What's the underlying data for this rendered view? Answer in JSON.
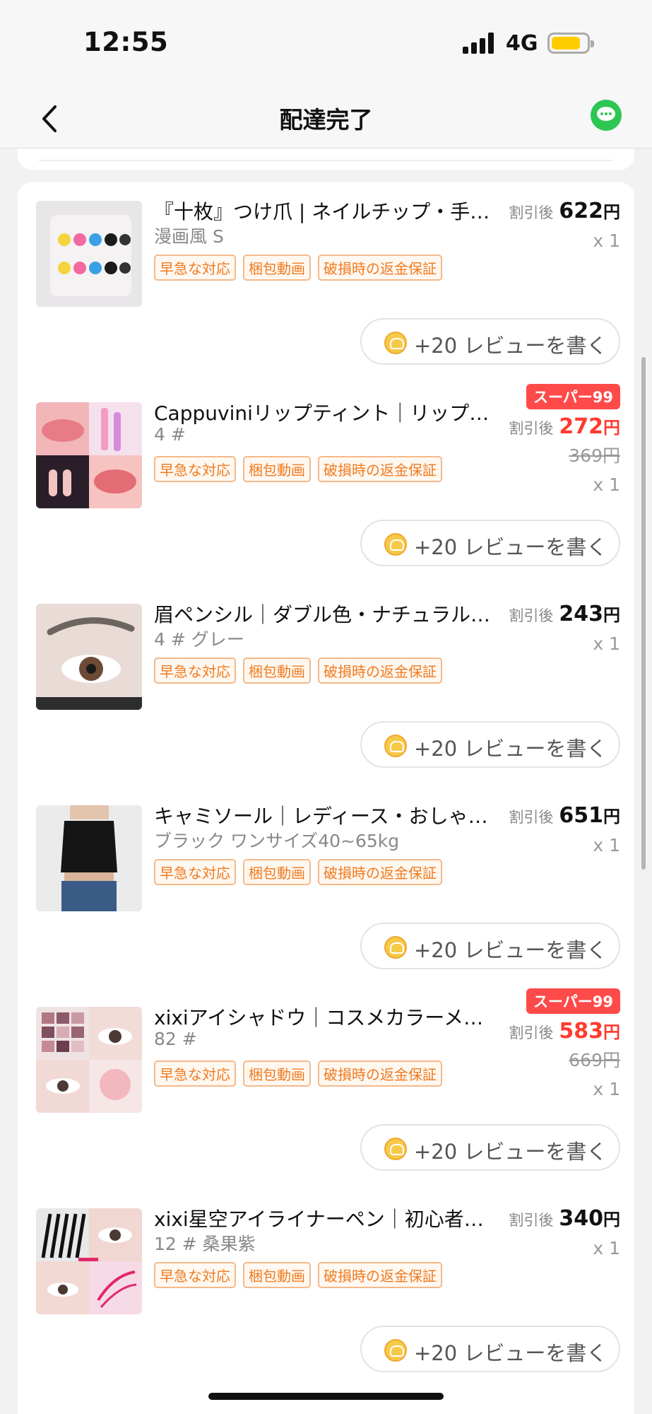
{
  "status": {
    "time": "12:55",
    "network": "4G"
  },
  "nav": {
    "title": "配達完了"
  },
  "items": [
    {
      "title": "『十枚』つけ爪 | ネイルチップ・手…",
      "variant": "漫画風 S",
      "tags": [
        "早急な対応",
        "梱包動画",
        "破損時の返金保証"
      ],
      "badge": "",
      "discount_label": "割引後",
      "price": "622",
      "currency": "円",
      "original_price": "",
      "qty": "x 1",
      "review": "+20 レビューを書く"
    },
    {
      "title": "Cappuviniリップティント｜リップ…",
      "variant": "4 #",
      "tags": [
        "早急な対応",
        "梱包動画",
        "破損時の返金保証"
      ],
      "badge": "スーパー99",
      "discount_label": "割引後",
      "price": "272",
      "currency": "円",
      "original_price": "369円",
      "qty": "x 1",
      "review": "+20 レビューを書く"
    },
    {
      "title": "眉ペンシル｜ダブル色・ナチュラル…",
      "variant": "4 # グレー",
      "tags": [
        "早急な対応",
        "梱包動画",
        "破損時の返金保証"
      ],
      "badge": "",
      "discount_label": "割引後",
      "price": "243",
      "currency": "円",
      "original_price": "",
      "qty": "x 1",
      "review": "+20 レビューを書く"
    },
    {
      "title": "キャミソール｜レディース・おしゃ…",
      "variant": "ブラック ワンサイズ40~65kg",
      "tags": [
        "早急な対応",
        "梱包動画",
        "破損時の返金保証"
      ],
      "badge": "",
      "discount_label": "割引後",
      "price": "651",
      "currency": "円",
      "original_price": "",
      "qty": "x 1",
      "review": "+20 レビューを書く"
    },
    {
      "title": "xixiアイシャドウ｜コスメカラーメ…",
      "variant": "82 #",
      "tags": [
        "早急な対応",
        "梱包動画",
        "破損時の返金保証"
      ],
      "badge": "スーパー99",
      "discount_label": "割引後",
      "price": "583",
      "currency": "円",
      "original_price": "669円",
      "qty": "x 1",
      "review": "+20 レビューを書く"
    },
    {
      "title": "xixi星空アイライナーペン｜初心者…",
      "variant": "12 # 桑果紫",
      "tags": [
        "早急な対応",
        "梱包動画",
        "破損時の返金保証"
      ],
      "badge": "",
      "discount_label": "割引後",
      "price": "340",
      "currency": "円",
      "original_price": "",
      "qty": "x 1",
      "review": "+20 レビューを書く"
    }
  ],
  "colors": {
    "accent_red": "#ff3b2f",
    "tag_orange": "#f07a1e",
    "chat_green": "#2dc653",
    "battery_yellow": "#ffcc00"
  },
  "icons": {
    "back": "chevron-left-icon",
    "chat": "chat-bubble-icon",
    "coin": "coin-icon"
  }
}
